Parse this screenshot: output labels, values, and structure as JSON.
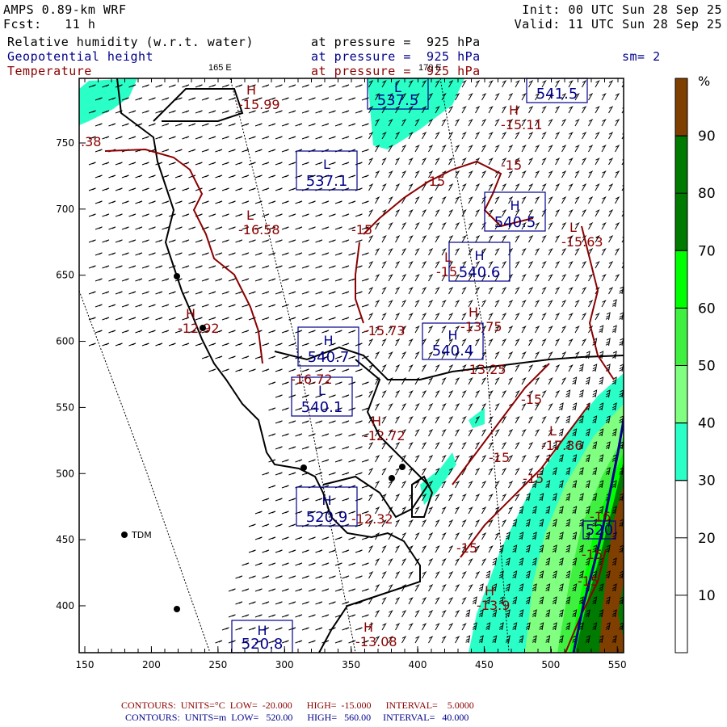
{
  "header": {
    "model": "AMPS 0.89-km WRF",
    "fcst": "Fcst:   11 h",
    "init": "Init: 00 UTC Sun 28 Sep 25",
    "valid": "Valid: 11 UTC Sun 28 Sep 25",
    "fields": [
      {
        "name": "Relative humidity (w.r.t. water)",
        "level": "at pressure =  925 hPa"
      },
      {
        "name": "Geopotential height",
        "level": "at pressure =  925 hPa"
      },
      {
        "name": "Temperature",
        "level": "at pressure =  925 hPa"
      }
    ],
    "smoothing": "sm= 2",
    "lon_labels": [
      "165 E",
      "170 E"
    ]
  },
  "axes": {
    "x_ticks": [
      "150",
      "200",
      "250",
      "300",
      "350",
      "400",
      "450",
      "500",
      "550"
    ],
    "y_ticks": [
      "750",
      "700",
      "650",
      "600",
      "550",
      "500",
      "450",
      "400"
    ]
  },
  "colorbar": {
    "unit": "%",
    "labels": [
      "90",
      "80",
      "70",
      "60",
      "50",
      "40",
      "30",
      "20",
      "10"
    ],
    "levels": [
      {
        "from": 0,
        "to": 30,
        "color": "#ffffff"
      },
      {
        "from": 30,
        "to": 40,
        "color": "#2affc8"
      },
      {
        "from": 40,
        "to": 50,
        "color": "#80ff80"
      },
      {
        "from": 50,
        "to": 60,
        "color": "#40f040"
      },
      {
        "from": 60,
        "to": 70,
        "color": "#00ff00"
      },
      {
        "from": 70,
        "to": 90,
        "color": "#007a00"
      },
      {
        "from": 90,
        "to": 100,
        "color": "#7f3f00"
      }
    ]
  },
  "station": {
    "name": "TDM"
  },
  "height_labels": [
    {
      "hl": "L",
      "value": "537.5"
    },
    {
      "hl": "",
      "value": "541.5"
    },
    {
      "hl": "L",
      "value": "537.1"
    },
    {
      "hl": "H",
      "value": "540.5"
    },
    {
      "hl": "H",
      "value": "540.6"
    },
    {
      "hl": "H",
      "value": "540.7"
    },
    {
      "hl": "H",
      "value": "540.4"
    },
    {
      "hl": "L",
      "value": "540.1"
    },
    {
      "hl": "H",
      "value": "520.9"
    },
    {
      "hl": "H",
      "value": "520.8"
    },
    {
      "hl": "",
      "value": "520"
    }
  ],
  "temp_labels": [
    {
      "hl": "H",
      "value": "-15.99"
    },
    {
      "hl": "H",
      "value": "-15.11"
    },
    {
      "hl": "",
      "value": "-15"
    },
    {
      "hl": "",
      "value": "-15"
    },
    {
      "hl": "",
      "value": "-15"
    },
    {
      "hl": "L",
      "value": "-16.58"
    },
    {
      "hl": "L",
      "value": "-15.63"
    },
    {
      "hl": "L",
      "value": "-15"
    },
    {
      "hl": "H",
      "value": "-12.92"
    },
    {
      "hl": "",
      "value": "-15.73"
    },
    {
      "hl": "H",
      "value": "-13.75"
    },
    {
      "hl": "",
      "value": "-13.25"
    },
    {
      "hl": "",
      "value": "-16.72"
    },
    {
      "hl": "H",
      "value": "-12.72"
    },
    {
      "hl": "",
      "value": "-15"
    },
    {
      "hl": "L",
      "value": "-17.36"
    },
    {
      "hl": "",
      "value": "-15"
    },
    {
      "hl": "",
      "value": "-15"
    },
    {
      "hl": "",
      "value": "-15"
    },
    {
      "hl": "H",
      "value": "-13.9"
    },
    {
      "hl": "",
      "value": "-16"
    },
    {
      "hl": "",
      "value": "-15"
    },
    {
      "hl": "",
      "value": "-15"
    },
    {
      "hl": "H",
      "value": "-13.08"
    },
    {
      "hl": "",
      "value": "-12.32"
    },
    {
      "hl": "",
      "value": ".38"
    }
  ],
  "footer": {
    "temp": {
      "label": "CONTOURS:  UNITS=°C",
      "low": "LOW=  -20.000",
      "high": "HIGH=  -15.000",
      "interval": "INTERVAL=    5.0000"
    },
    "height": {
      "label": "CONTOURS:  UNITS=m",
      "low": "LOW=   520.00",
      "high": "HIGH=   560.00",
      "interval": "INTERVAL=   40.000"
    }
  }
}
